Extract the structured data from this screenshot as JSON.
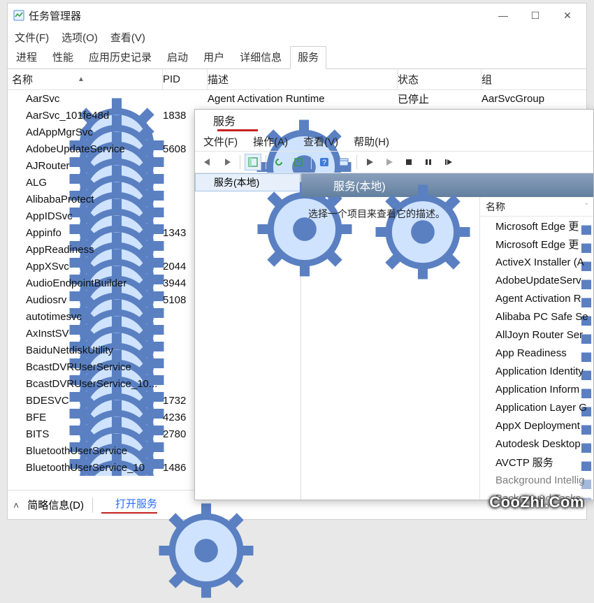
{
  "task_manager": {
    "title": "任务管理器",
    "menu": {
      "file": "文件(F)",
      "options": "选项(O)",
      "view": "查看(V)"
    },
    "tabs": {
      "processes": "进程",
      "performance": "性能",
      "app_history": "应用历史记录",
      "startup": "启动",
      "users": "用户",
      "details": "详细信息",
      "services": "服务"
    },
    "columns": {
      "name": "名称",
      "pid": "PID",
      "desc": "描述",
      "state": "状态",
      "group": "组"
    },
    "top_row": {
      "desc": "Agent Activation Runtime",
      "state": "已停止",
      "group": "AarSvcGroup"
    },
    "rows": [
      {
        "name": "AarSvc",
        "pid": ""
      },
      {
        "name": "AarSvc_101fe48d",
        "pid": "1838"
      },
      {
        "name": "AdAppMgrSvc",
        "pid": ""
      },
      {
        "name": "AdobeUpdateService",
        "pid": "5608"
      },
      {
        "name": "AJRouter",
        "pid": ""
      },
      {
        "name": "ALG",
        "pid": ""
      },
      {
        "name": "AlibabaProtect",
        "pid": ""
      },
      {
        "name": "AppIDSvc",
        "pid": ""
      },
      {
        "name": "Appinfo",
        "pid": "1343"
      },
      {
        "name": "AppReadiness",
        "pid": ""
      },
      {
        "name": "AppXSvc",
        "pid": "2044"
      },
      {
        "name": "AudioEndpointBuilder",
        "pid": "3944"
      },
      {
        "name": "Audiosrv",
        "pid": "5108"
      },
      {
        "name": "autotimesvc",
        "pid": ""
      },
      {
        "name": "AxInstSV",
        "pid": ""
      },
      {
        "name": "BaiduNetdiskUtility",
        "pid": ""
      },
      {
        "name": "BcastDVRUserService",
        "pid": ""
      },
      {
        "name": "BcastDVRUserService_10...",
        "pid": ""
      },
      {
        "name": "BDESVC",
        "pid": "1732"
      },
      {
        "name": "BFE",
        "pid": "4236"
      },
      {
        "name": "BITS",
        "pid": "2780"
      },
      {
        "name": "BluetoothUserService",
        "pid": ""
      },
      {
        "name": "BluetoothUserService_10",
        "pid": "1486"
      }
    ],
    "footer": {
      "brief": "简略信息(D)",
      "open_services": "打开服务"
    }
  },
  "services_window": {
    "title": "服务",
    "menu": {
      "file": "文件(F)",
      "action": "操作(A)",
      "view": "查看(V)",
      "help": "帮助(H)"
    },
    "tree_node": "服务(本地)",
    "main_header": "服务(本地)",
    "detail_hint": "选择一个项目来查看它的描述。",
    "list_header_name": "名称",
    "rows": [
      "Microsoft Edge 更",
      "Microsoft Edge 更",
      "ActiveX Installer (A",
      "AdobeUpdateServ",
      "Agent Activation R",
      "Alibaba PC Safe Se",
      "AllJoyn Router Ser",
      "App Readiness",
      "Application Identity",
      "Application Inform",
      "Application Layer G",
      "AppX Deployment",
      "Autodesk Desktop",
      "AVCTP 服务",
      "Background Intellig",
      "Background Tasks"
    ]
  },
  "icons": {
    "gear": "gear-icon",
    "back": "back-icon",
    "forward": "forward-icon",
    "panel": "panel-icon",
    "refresh": "refresh-icon",
    "export": "export-icon",
    "help": "help-icon",
    "props": "properties-icon",
    "play": "play-icon",
    "play2": "play2-icon",
    "stop": "stop-icon",
    "pause": "pause-icon",
    "restart": "restart-icon"
  },
  "watermark": "CooZhi.Com"
}
